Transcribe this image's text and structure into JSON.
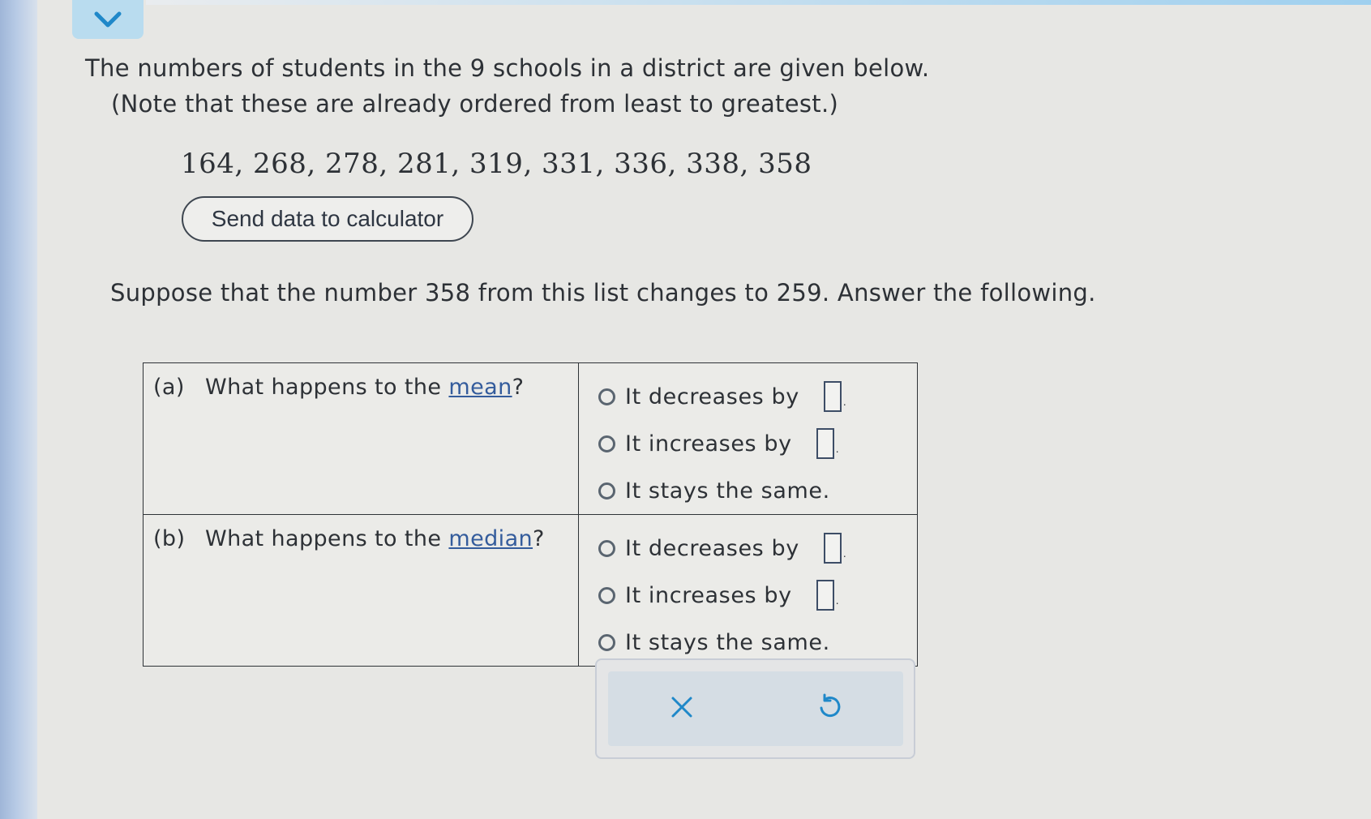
{
  "header": {
    "collapse_icon": "chevron-down-icon"
  },
  "problem": {
    "intro_line1": "The numbers of students in the 9 schools in a district are given below.",
    "intro_line2": "(Note that these are already ordered from least to greatest.)",
    "dataset": "164, 268, 278, 281, 319, 331, 336, 338, 358",
    "send_button_label": "Send data to calculator",
    "change_statement": "Suppose that the number 358 from this list changes to 259. Answer the following."
  },
  "questions": [
    {
      "tag": "(a)",
      "prefix": "What happens to the ",
      "link": "mean",
      "suffix": "?",
      "options": [
        {
          "label": "It decreases by",
          "has_input": true,
          "value": ""
        },
        {
          "label": "It increases by",
          "has_input": true,
          "value": ""
        },
        {
          "label": "It stays the same.",
          "has_input": false
        }
      ]
    },
    {
      "tag": "(b)",
      "prefix": "What happens to the ",
      "link": "median",
      "suffix": "?",
      "options": [
        {
          "label": "It decreases by",
          "has_input": true,
          "value": ""
        },
        {
          "label": "It increases by",
          "has_input": true,
          "value": ""
        },
        {
          "label": "It stays the same.",
          "has_input": false
        }
      ]
    }
  ],
  "actions": {
    "clear_icon": "close-icon",
    "undo_icon": "undo-icon"
  },
  "colors": {
    "accent": "#1f88c9",
    "tab_bg": "#b9dcef",
    "link": "#345c9c"
  }
}
